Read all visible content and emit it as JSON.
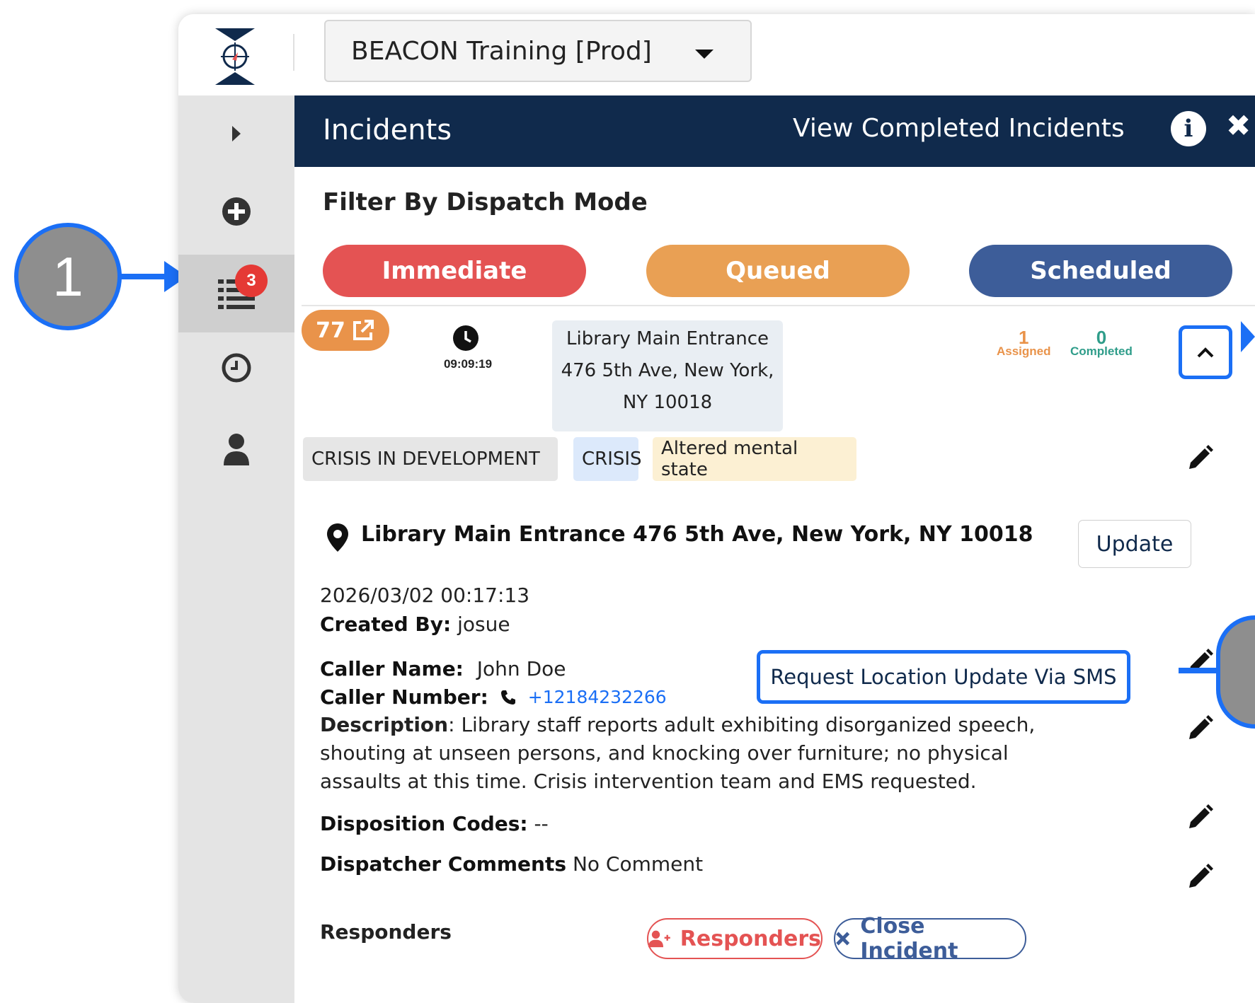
{
  "topbar": {
    "org_name": "BEACON Training [Prod]"
  },
  "sidebar": {
    "list_badge_count": "3"
  },
  "header": {
    "title": "Incidents",
    "view_completed": "View Completed Incidents",
    "info_label": "i",
    "close_label": "✖"
  },
  "filter": {
    "title": "Filter By Dispatch Mode",
    "immediate": "Immediate",
    "queued": "Queued",
    "scheduled": "Scheduled"
  },
  "incident": {
    "number": "77",
    "timer": "09:09:19",
    "address_lines": [
      "Library Main Entrance",
      "476 5th Ave, New York,",
      "NY 10018"
    ],
    "assigned_count": "1",
    "assigned_label": "Assigned",
    "completed_count": "0",
    "completed_label": "Completed",
    "tags": [
      "CRISIS IN DEVELOPMENT",
      "CRISIS",
      "Altered mental state"
    ],
    "location_full": "Library Main Entrance 476 5th Ave, New York, NY 10018",
    "update_label": "Update",
    "created_at": "2026/03/02 00:17:13",
    "created_by_label": "Created By:",
    "created_by": "josue",
    "caller_name_label": "Caller Name:",
    "caller_name": "John Doe",
    "caller_number_label": "Caller Number:",
    "caller_number": "+12184232266",
    "sms_button": "Request Location Update Via SMS",
    "description_label": "Description",
    "description": "Library staff reports adult exhibiting disorganized speech, shouting at unseen persons, and knocking over furniture; no physical assaults at this time. Crisis intervention team and EMS requested.",
    "disposition_label": "Disposition Codes:",
    "disposition_value": "--",
    "dispatcher_label": "Dispatcher Comments",
    "dispatcher_value": "No Comment",
    "responders_label": "Responders",
    "responders_button": "Responders",
    "close_button": "Close Incident"
  },
  "callouts": {
    "one": "1"
  },
  "colors": {
    "navy": "#102a4c",
    "immediate": "#e45353",
    "queued": "#e9a054",
    "scheduled": "#3d5d99",
    "highlight": "#1b6ff5"
  }
}
